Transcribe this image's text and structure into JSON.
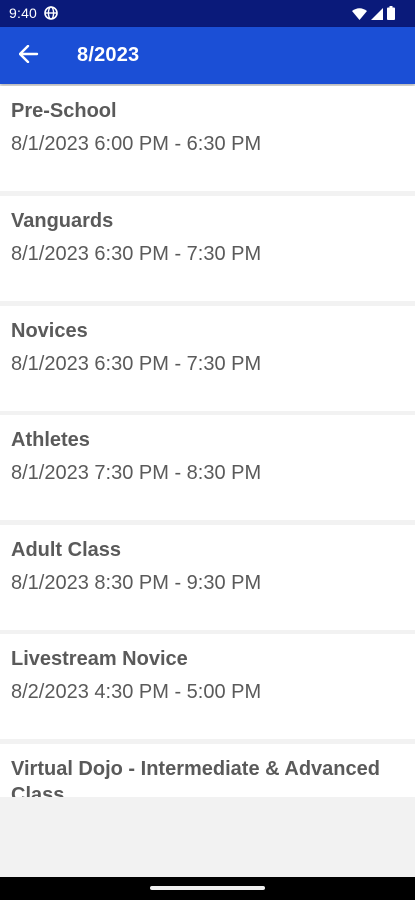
{
  "status_bar": {
    "time": "9:40",
    "icons": [
      "globe-icon",
      "wifi-icon",
      "signal-icon",
      "battery-icon"
    ]
  },
  "app_bar": {
    "title": "8/2023",
    "back_icon": "arrow-back-icon",
    "color": "#1b4fd6"
  },
  "events": [
    {
      "title": "Pre-School",
      "time": "8/1/2023 6:00 PM - 6:30 PM"
    },
    {
      "title": "Vanguards",
      "time": "8/1/2023 6:30 PM - 7:30 PM"
    },
    {
      "title": "Novices",
      "time": "8/1/2023 6:30 PM - 7:30 PM"
    },
    {
      "title": "Athletes",
      "time": "8/1/2023 7:30 PM - 8:30 PM"
    },
    {
      "title": "Adult Class",
      "time": "8/1/2023 8:30 PM - 9:30 PM"
    },
    {
      "title": "Livestream Novice",
      "time": "8/2/2023 4:30 PM - 5:00 PM"
    },
    {
      "title": "Virtual Dojo - Intermediate & Advanced Class",
      "time": ""
    }
  ]
}
